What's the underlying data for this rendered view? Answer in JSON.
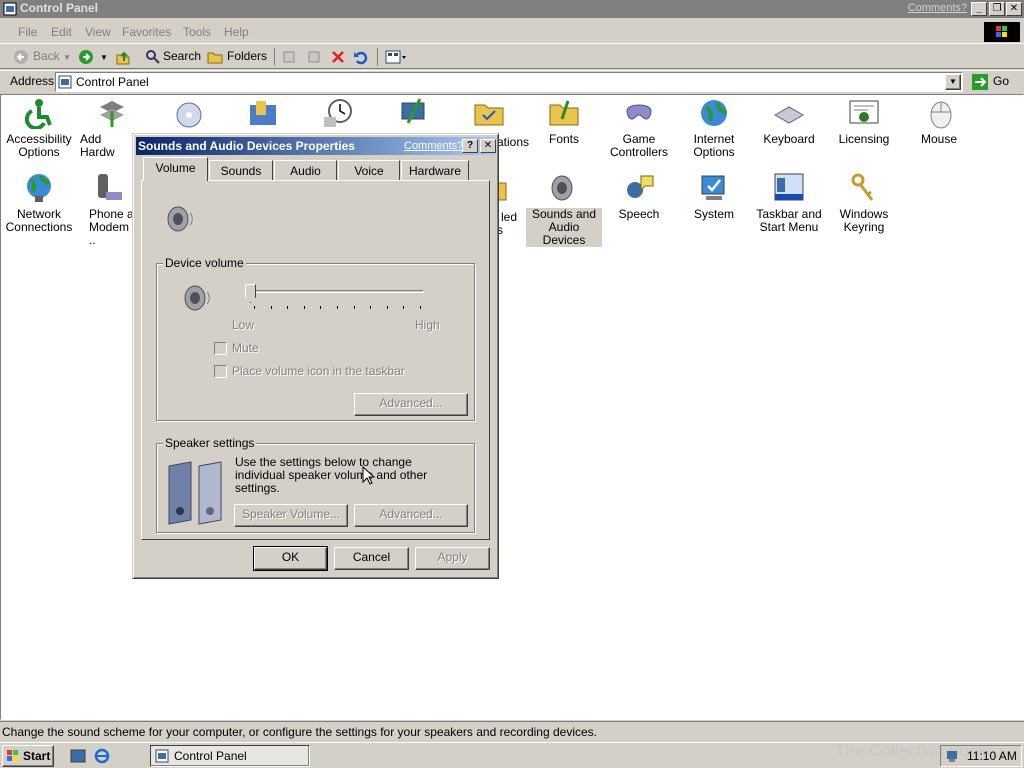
{
  "window": {
    "title": "Control Panel",
    "comments_link": "Comments?",
    "min_glyph": "_",
    "max_glyph": "❐",
    "close_glyph": "✕"
  },
  "menu": [
    "File",
    "Edit",
    "View",
    "Favorites",
    "Tools",
    "Help"
  ],
  "toolbar": {
    "back": "Back",
    "search": "Search",
    "folders": "Folders"
  },
  "address": {
    "label": "Address",
    "value": "Control Panel",
    "go": "Go"
  },
  "icons_row1": [
    {
      "label": "Accessibility Options",
      "icon": "accessibility-icon"
    },
    {
      "label": "Add Hardw",
      "icon": "add-hardware-icon"
    },
    {
      "label": "Fonts",
      "icon": "fonts-folder-icon"
    },
    {
      "label": "Game Controllers",
      "icon": "game-controller-icon"
    },
    {
      "label": "Internet Options",
      "icon": "internet-globe-icon"
    },
    {
      "label": "Keyboard",
      "icon": "keyboard-icon"
    },
    {
      "label": "Licensing",
      "icon": "certificate-icon"
    },
    {
      "label": "Mouse",
      "icon": "mouse-icon"
    }
  ],
  "partial_labels": {
    "ations": "ations",
    "led": "led",
    "s": "s"
  },
  "icons_row2": [
    {
      "label": "Network Connections",
      "icon": "network-globe-icon"
    },
    {
      "label": "Phone ar Modem ..",
      "icon": "phone-modem-icon"
    },
    {
      "label": "Sounds and Audio Devices",
      "icon": "speaker-icon"
    },
    {
      "label": "Speech",
      "icon": "speech-icon"
    },
    {
      "label": "System",
      "icon": "system-computer-icon"
    },
    {
      "label": "Taskbar and Start Menu",
      "icon": "taskbar-icon"
    },
    {
      "label": "Windows Keyring",
      "icon": "keys-icon"
    }
  ],
  "dialog": {
    "title": "Sounds and Audio Devices Properties",
    "comments": "Comments?",
    "help_glyph": "?",
    "close_glyph": "✕",
    "tabs": [
      "Volume",
      "Sounds",
      "Audio",
      "Voice",
      "Hardware"
    ],
    "device_volume": {
      "label": "Device volume",
      "low": "Low",
      "high": "High",
      "level": 0.0,
      "mute": "Mute",
      "place_icon": "Place volume icon in the taskbar",
      "advanced": "Advanced..."
    },
    "speaker_settings": {
      "label": "Speaker settings",
      "text": "Use the settings below to change individual speaker volume and other settings.",
      "speaker_volume": "Speaker Volume...",
      "advanced": "Advanced..."
    },
    "ok": "OK",
    "cancel": "Cancel",
    "apply": "Apply"
  },
  "status_text": "Change the sound scheme for your computer, or configure the settings for your speakers and recording devices.",
  "taskbar": {
    "start": "Start",
    "task": "Control Panel",
    "clock": "11:10 AM",
    "watermark": "The Collection Book"
  }
}
